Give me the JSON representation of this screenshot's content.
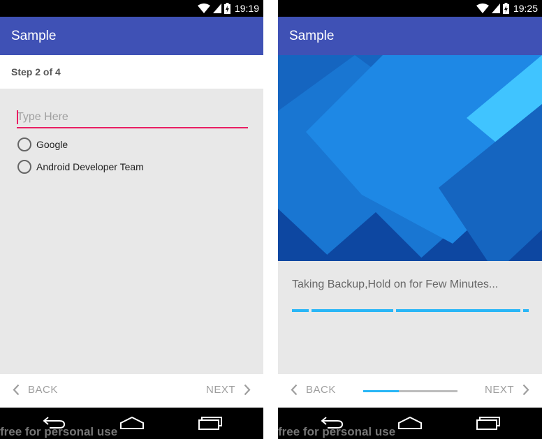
{
  "colors": {
    "app_bar": "#3f51b5",
    "accent": "#e91e63",
    "progress": "#29b6f6",
    "background": "#e8e8e8"
  },
  "screen1": {
    "status": {
      "time": "19:19"
    },
    "app_title": "Sample",
    "step_label": "Step 2 of 4",
    "input": {
      "value": "",
      "placeholder": "Type Here"
    },
    "radio_options": [
      "Google",
      "Android Developer Team"
    ],
    "back_label": "BACK",
    "next_label": "NEXT",
    "watermark": "free for personal use"
  },
  "screen2": {
    "status": {
      "time": "19:25"
    },
    "app_title": "Sample",
    "message": "Taking Backup,Hold on for Few Minutes...",
    "back_label": "BACK",
    "next_label": "NEXT",
    "step_progress": 0.38,
    "watermark": "free for personal use"
  }
}
